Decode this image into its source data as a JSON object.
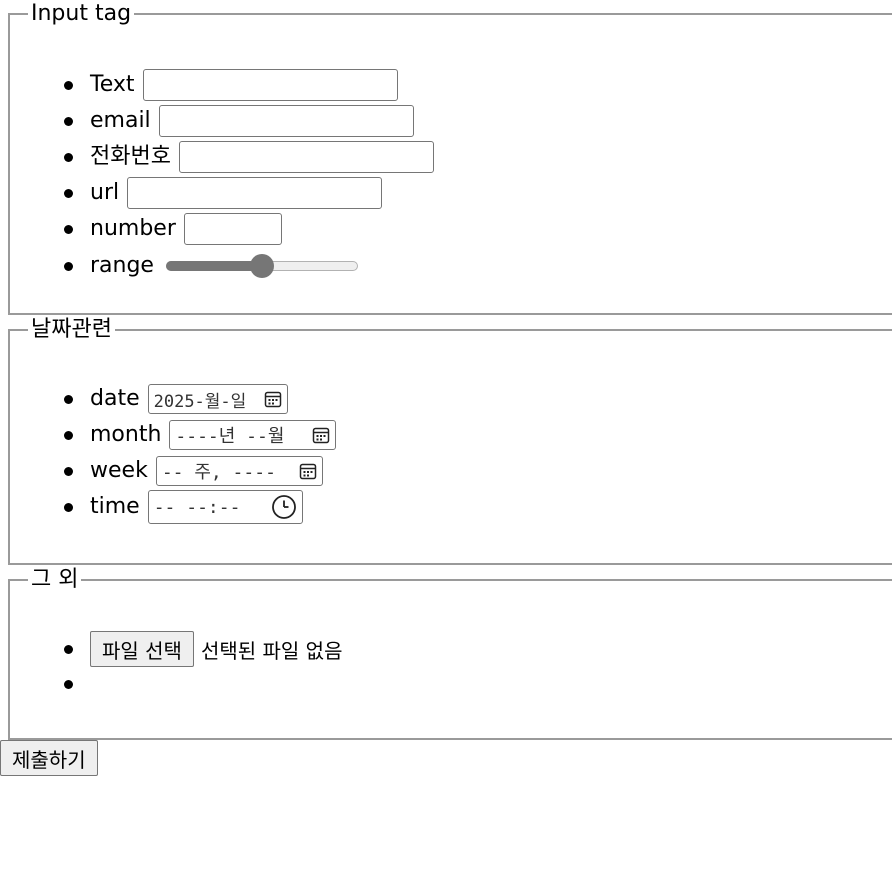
{
  "fieldsets": [
    {
      "legend": "Input tag",
      "items": [
        {
          "label": "Text",
          "value": ""
        },
        {
          "label": "email",
          "value": ""
        },
        {
          "label": "전화번호",
          "value": ""
        },
        {
          "label": "url",
          "value": ""
        },
        {
          "label": "number",
          "value": ""
        },
        {
          "label": "range",
          "value": 0.5
        }
      ]
    },
    {
      "legend": "날짜관련",
      "items": [
        {
          "label": "date",
          "value": "2025-월-일",
          "icon": "calendar-icon"
        },
        {
          "label": "month",
          "value": "----년 --월",
          "icon": "calendar-icon"
        },
        {
          "label": "week",
          "value": "-- 주, ----",
          "icon": "calendar-icon"
        },
        {
          "label": "time",
          "value": "-- --:--",
          "icon": "clock-icon"
        }
      ]
    },
    {
      "legend": "그 외",
      "items": [
        {
          "button": "파일 선택",
          "status": "선택된 파일 없음"
        }
      ]
    }
  ],
  "submit_label": "제출하기"
}
